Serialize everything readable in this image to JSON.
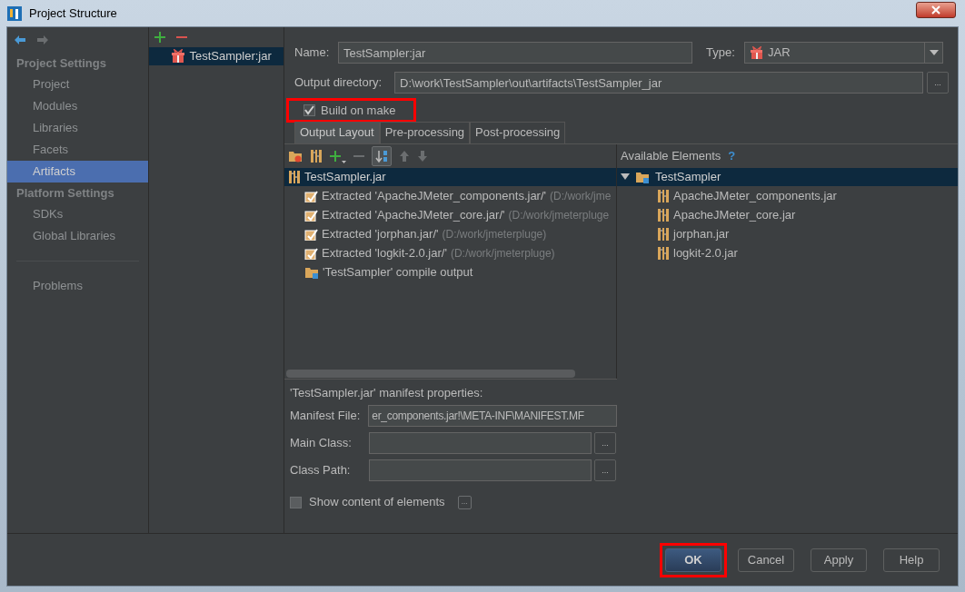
{
  "window": {
    "title": "Project Structure"
  },
  "sidebar": {
    "sections": [
      {
        "heading": "Project Settings",
        "items": [
          {
            "label": "Project",
            "selected": false
          },
          {
            "label": "Modules",
            "selected": false
          },
          {
            "label": "Libraries",
            "selected": false
          },
          {
            "label": "Facets",
            "selected": false
          },
          {
            "label": "Artifacts",
            "selected": true
          }
        ]
      },
      {
        "heading": "Platform Settings",
        "items": [
          {
            "label": "SDKs",
            "selected": false
          },
          {
            "label": "Global Libraries",
            "selected": false
          }
        ]
      }
    ],
    "footer_items": [
      {
        "label": "Problems",
        "selected": false
      }
    ]
  },
  "artifacts": [
    {
      "label": "TestSampler:jar",
      "selected": true
    }
  ],
  "form": {
    "name_label": "Name:",
    "name": "TestSampler:jar",
    "type_label": "Type:",
    "type": "JAR",
    "output_label": "Output directory:",
    "output_dir": "D:\\work\\TestSampler\\out\\artifacts\\TestSampler_jar",
    "browse": "...",
    "build_on_make": {
      "label": "Build on make",
      "checked": true,
      "highlighted": true
    }
  },
  "tabs": [
    {
      "label": "Output Layout",
      "selected": true
    },
    {
      "label": "Pre-processing",
      "selected": false
    },
    {
      "label": "Post-processing",
      "selected": false
    }
  ],
  "layout_tree": {
    "root": {
      "label": "TestSampler.jar",
      "selected": true
    },
    "children": [
      {
        "kind": "extracted",
        "label": "Extracted 'ApacheJMeter_components.jar/'",
        "path": "(D:/work/jme",
        "selected": false
      },
      {
        "kind": "extracted",
        "label": "Extracted 'ApacheJMeter_core.jar/'",
        "path": "(D:/work/jmeterpluge",
        "selected": false
      },
      {
        "kind": "extracted",
        "label": "Extracted 'jorphan.jar/'",
        "path": "(D:/work/jmeterpluge)",
        "selected": false
      },
      {
        "kind": "extracted",
        "label": "Extracted 'logkit-2.0.jar/'",
        "path": "(D:/work/jmeterpluge)",
        "selected": false
      },
      {
        "kind": "output",
        "label": "'TestSampler' compile output",
        "selected": false
      }
    ]
  },
  "available": {
    "title": "Available Elements",
    "help": "?",
    "root": {
      "label": "TestSampler",
      "expanded": true,
      "selected": true,
      "children": [
        {
          "label": "ApacheJMeter_components.jar",
          "selected": false
        },
        {
          "label": "ApacheJMeter_core.jar",
          "selected": false
        },
        {
          "label": "jorphan.jar",
          "selected": false
        },
        {
          "label": "logkit-2.0.jar",
          "selected": false
        }
      ]
    }
  },
  "manifest": {
    "title": "'TestSampler.jar' manifest properties:",
    "fields": [
      {
        "label": "Manifest File:",
        "value": "er_components.jar!\\META-INF\\MANIFEST.MF"
      },
      {
        "label": "Main Class:",
        "button": "..."
      },
      {
        "label": "Class Path:",
        "button": "..."
      }
    ],
    "show_content": {
      "label": "Show content of elements",
      "checked": false,
      "button": "..."
    }
  },
  "buttons": [
    {
      "label": "OK",
      "default": true,
      "highlighted": true
    },
    {
      "label": "Cancel",
      "default": false,
      "highlighted": false
    },
    {
      "label": "Apply",
      "default": false,
      "highlighted": false
    },
    {
      "label": "Help",
      "default": false,
      "highlighted": false
    }
  ]
}
